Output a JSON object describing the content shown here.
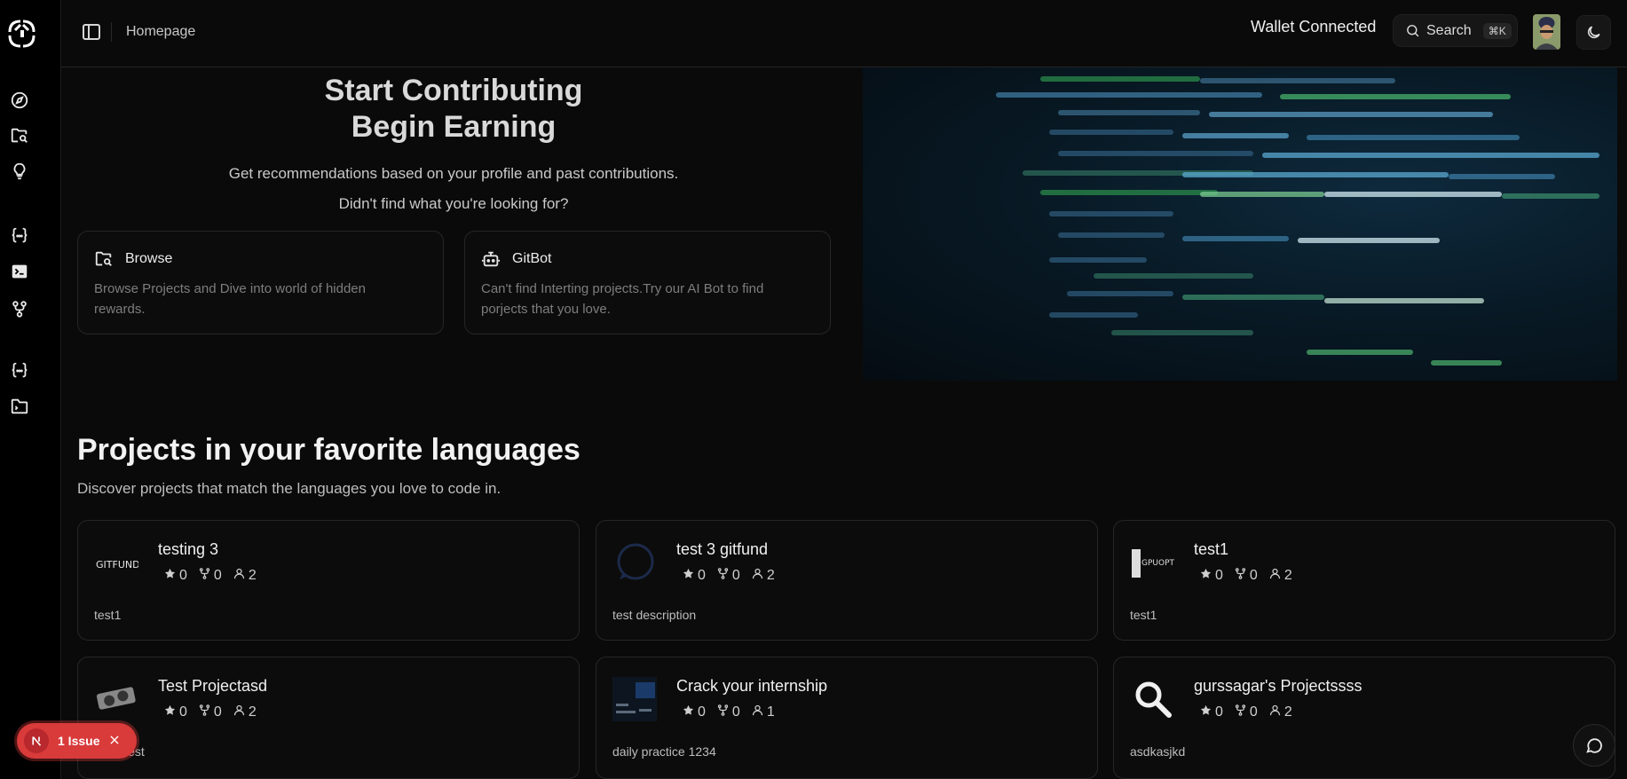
{
  "topbar": {
    "breadcrumb": "Homepage",
    "wallet_status": "Wallet Connected",
    "search_label": "Search",
    "search_shortcut": "⌘K"
  },
  "hero": {
    "title_line1": "Start Contributing",
    "title_line2": "Begin Earning",
    "subtitle": "Get recommendations based on your profile and past contributions.",
    "subtitle2": "Didn't find what you're looking for?",
    "cards": [
      {
        "title": "Browse",
        "description": "Browse Projects and Dive into world of hidden rewards.",
        "icon": "folder-search-icon"
      },
      {
        "title": "GitBot",
        "description": "Can't find Interting projects.Try our AI Bot to find porjects that you love.",
        "icon": "bot-icon"
      }
    ]
  },
  "section": {
    "title": "Projects in your favorite languages",
    "subtitle": "Discover projects that match the languages you love to code in."
  },
  "projects": [
    {
      "name": "testing 3",
      "stars": "0",
      "forks": "0",
      "contributors": "2",
      "description": "test1",
      "thumb_text": "GITFUND"
    },
    {
      "name": "test 3 gitfund",
      "stars": "0",
      "forks": "0",
      "contributors": "2",
      "description": "test description"
    },
    {
      "name": "test1",
      "stars": "0",
      "forks": "0",
      "contributors": "2",
      "description": "test1",
      "thumb_text": "GPUOPTIM"
    },
    {
      "name": "Test Projectasd",
      "stars": "0",
      "forks": "0",
      "contributors": "2",
      "description": "ption test"
    },
    {
      "name": "Crack your internship",
      "stars": "0",
      "forks": "0",
      "contributors": "1",
      "description": "daily practice 1234"
    },
    {
      "name": "gurssagar's Projectssss",
      "stars": "0",
      "forks": "0",
      "contributors": "2",
      "description": "asdkasjkd"
    }
  ],
  "issue_badge": {
    "label": "1 Issue"
  },
  "colors": {
    "background": "#0a0a0a",
    "sidebar": "#000000",
    "issue_red": "#d93a3a"
  }
}
